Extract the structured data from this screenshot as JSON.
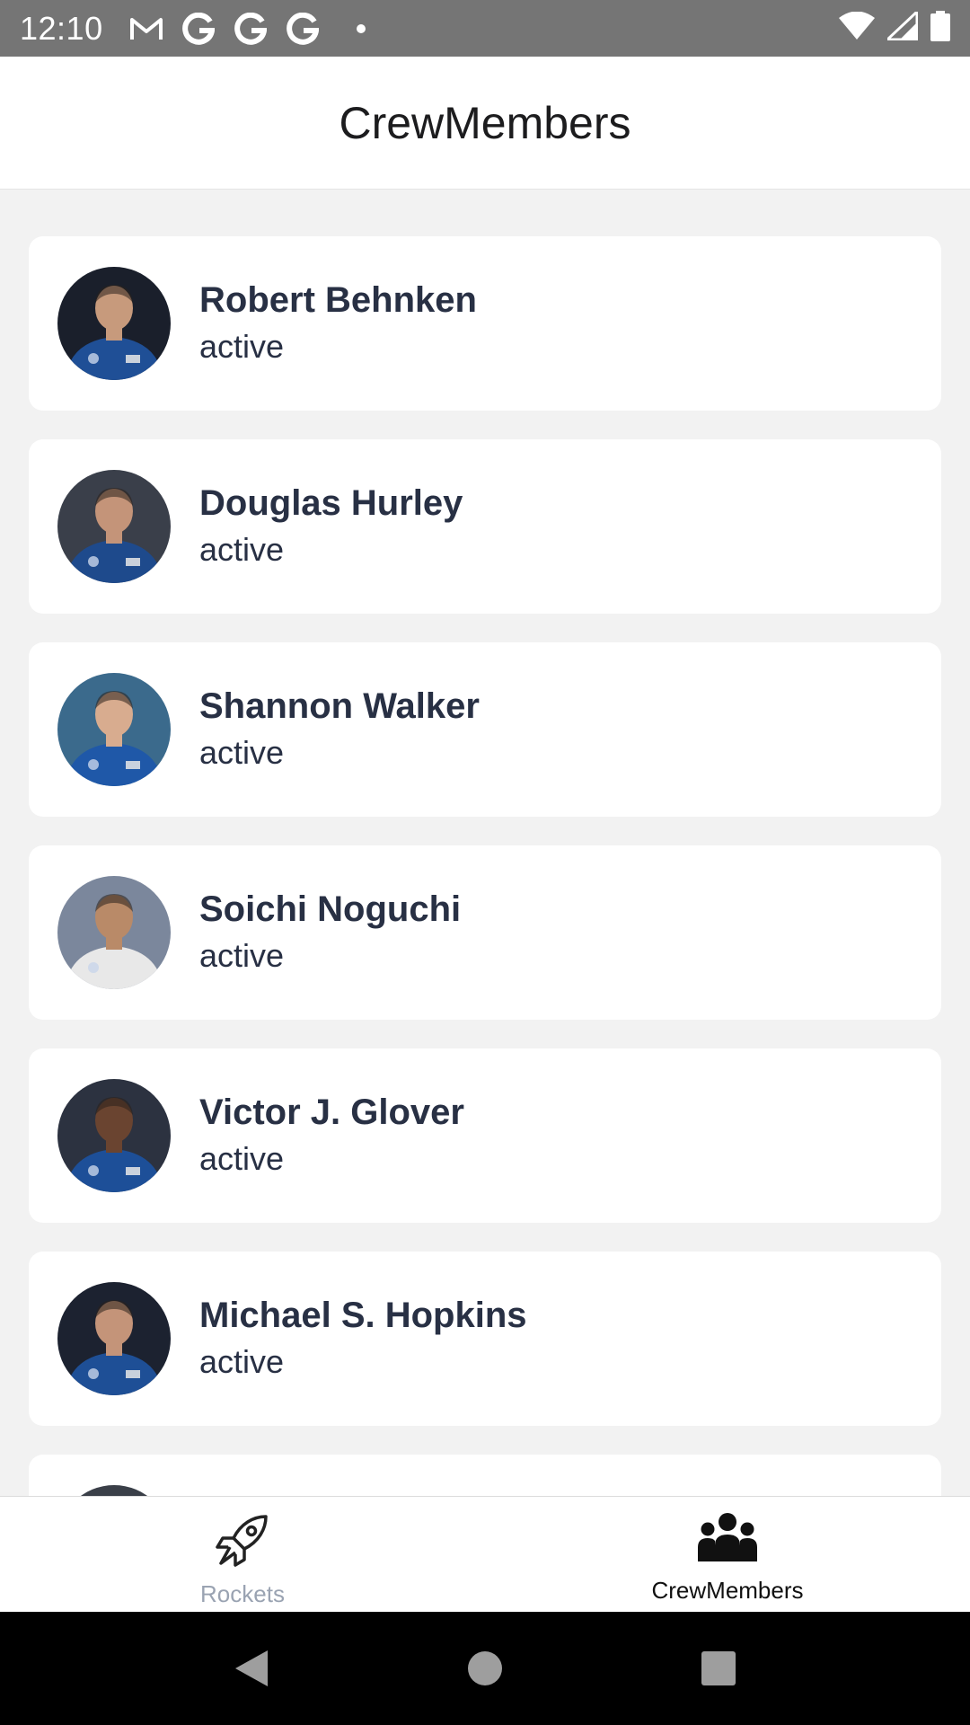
{
  "status_bar": {
    "time": "12:10",
    "left_icons": [
      "gmail-icon",
      "google-icon",
      "google-icon",
      "google-icon",
      "notification-dot-icon"
    ],
    "right_icons": [
      "wifi-icon",
      "signal-icon",
      "battery-icon"
    ]
  },
  "header": {
    "title": "CrewMembers"
  },
  "crew": [
    {
      "name": "Robert Behnken",
      "status": "active",
      "avatar": "astronaut-photo",
      "bg": "#1a1f2b",
      "suit": "#1f4f96",
      "skin": "#c79a7c"
    },
    {
      "name": "Douglas Hurley",
      "status": "active",
      "avatar": "astronaut-photo",
      "bg": "#3a3f4a",
      "suit": "#1e4a8c",
      "skin": "#c49479"
    },
    {
      "name": "Shannon Walker",
      "status": "active",
      "avatar": "astronaut-photo",
      "bg": "#3b6a8c",
      "suit": "#1f58a8",
      "skin": "#d8ac8f"
    },
    {
      "name": "Soichi Noguchi",
      "status": "active",
      "avatar": "astronaut-photo",
      "bg": "#7b879c",
      "suit": "#e8e8e8",
      "skin": "#b98a68"
    },
    {
      "name": "Victor J. Glover",
      "status": "active",
      "avatar": "astronaut-photo",
      "bg": "#2c3240",
      "suit": "#1d4f98",
      "skin": "#6a4430"
    },
    {
      "name": "Michael S. Hopkins",
      "status": "active",
      "avatar": "astronaut-photo",
      "bg": "#1c2230",
      "suit": "#1e4f96",
      "skin": "#c49479"
    },
    {
      "name": "",
      "status": "",
      "avatar": "astronaut-photo",
      "bg": "#3a3f48",
      "suit": "#1e4f96",
      "skin": "#c49479"
    }
  ],
  "tabs": [
    {
      "label": "Rockets",
      "icon": "rocket-icon",
      "active": false
    },
    {
      "label": "CrewMembers",
      "icon": "users-icon",
      "active": true
    }
  ],
  "nav": [
    "back-triangle-icon",
    "home-circle-icon",
    "recents-square-icon"
  ],
  "colors": {
    "status_bar": "#757575",
    "background": "#f2f2f2",
    "card": "#ffffff",
    "text_primary": "#283044",
    "tab_inactive": "#9aa3b2",
    "tab_active": "#111111"
  }
}
